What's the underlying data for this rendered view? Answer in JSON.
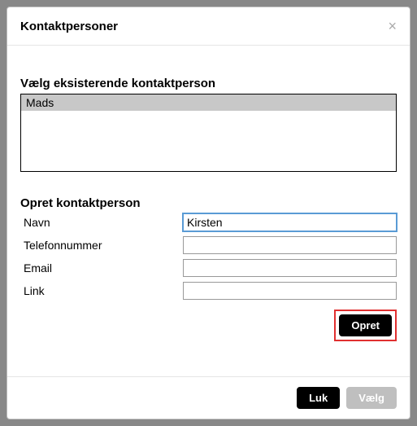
{
  "modal": {
    "title": "Kontaktpersoner",
    "close_symbol": "×"
  },
  "existing": {
    "heading": "Vælg eksisterende kontaktperson",
    "items": [
      "Mads"
    ]
  },
  "create": {
    "heading": "Opret kontaktperson",
    "fields": {
      "name": {
        "label": "Navn",
        "value": "Kirsten"
      },
      "phone": {
        "label": "Telefonnummer",
        "value": ""
      },
      "email": {
        "label": "Email",
        "value": ""
      },
      "link": {
        "label": "Link",
        "value": ""
      }
    },
    "submit_label": "Opret"
  },
  "footer": {
    "close_label": "Luk",
    "select_label": "Vælg"
  }
}
